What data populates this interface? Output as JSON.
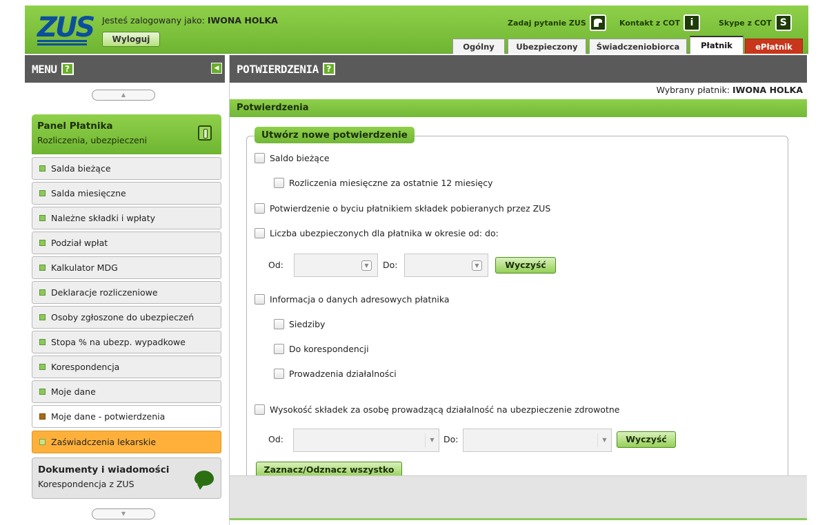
{
  "header": {
    "logo": "ZUS",
    "logged_in_label": "Jesteś zalogowany jako:",
    "user_name": "IWONA HOLKA",
    "logout_label": "Wyloguj",
    "links": [
      {
        "label": "Zadaj pytanie ZUS",
        "icon": "question-bubble-icon"
      },
      {
        "label": "Kontakt z COT",
        "icon": "info-icon"
      },
      {
        "label": "Skype z COT",
        "icon": "skype-icon"
      }
    ],
    "tabs": [
      {
        "label": "Ogólny",
        "active": false
      },
      {
        "label": "Ubezpieczony",
        "active": false
      },
      {
        "label": "Świadczeniobiorca",
        "active": false
      },
      {
        "label": "Płatnik",
        "active": true
      },
      {
        "label": "ePłatnik",
        "active": false
      }
    ]
  },
  "sidebar": {
    "title": "MENU",
    "help_label": "?",
    "panel": {
      "title": "Panel Płatnika",
      "subtitle": "Rozliczenia, ubezpieczeni"
    },
    "items": [
      {
        "label": "Salda bieżące"
      },
      {
        "label": "Salda miesięczne"
      },
      {
        "label": "Należne składki i wpłaty"
      },
      {
        "label": "Podział wpłat"
      },
      {
        "label": "Kalkulator MDG"
      },
      {
        "label": "Deklaracje rozliczeniowe"
      },
      {
        "label": "Osoby zgłoszone do ubezpieczeń"
      },
      {
        "label": "Stopa % na ubezp. wypadkowe"
      },
      {
        "label": "Korespondencja"
      },
      {
        "label": "Moje dane"
      },
      {
        "label": "Moje dane - potwierdzenia"
      },
      {
        "label": "Zaświadczenia lekarskie"
      }
    ],
    "docs": {
      "title": "Dokumenty i wiadomości",
      "subtitle": "Korespondencja z ZUS"
    }
  },
  "main": {
    "title": "POTWIERDZENIA",
    "help_label": "?",
    "payer_label": "Wybrany płatnik:",
    "payer_name": "IWONA HOLKA",
    "section_title": "Potwierdzenia",
    "legend": "Utwórz nowe potwierdzenie",
    "options": {
      "saldo": "Saldo bieżące",
      "rozliczenia": "Rozliczenia miesięczne za ostatnie 12 miesięcy",
      "platnik": "Potwierdzenie o byciu płatnikiem składek pobieranych przez ZUS",
      "liczba": "Liczba ubezpieczonych dla płatnika w okresie od: do:",
      "adres": "Informacja o danych adresowych płatnika",
      "siedziby": "Siedziby",
      "korespondencji": "Do korespondencji",
      "dzialalnosci": "Prowadzenia działalności",
      "wysokosc": "Wysokość składek za osobę prowadzącą działalność na ubezpieczenie zdrowotne"
    },
    "od_label": "Od:",
    "do_label": "Do:",
    "clear_label": "Wyczyść",
    "select_all_label": "Zaznacz/Odznacz wszystko"
  }
}
